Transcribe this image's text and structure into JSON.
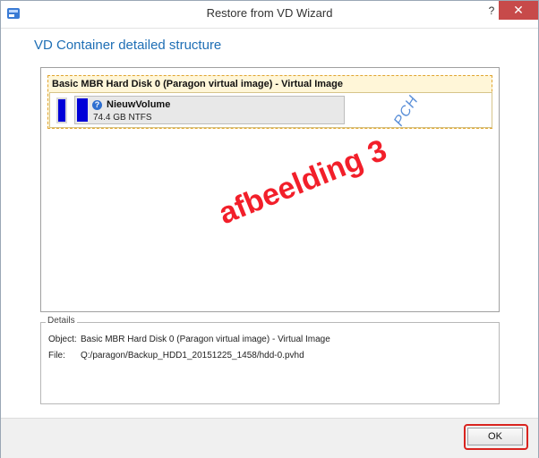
{
  "window": {
    "title": "Restore from VD Wizard",
    "help_label": "?",
    "close_label": "✕"
  },
  "heading": "VD Container detailed structure",
  "disk": {
    "title": "Basic MBR Hard Disk 0 (Paragon virtual image) - Virtual Image",
    "volume": {
      "name": "NieuwVolume",
      "size": "74.4 GB NTFS",
      "icon": "?"
    }
  },
  "annotations": {
    "pch": "PCH",
    "watermark": "afbeelding 3"
  },
  "details": {
    "legend": "Details",
    "object_label": "Object:",
    "object_value": "Basic MBR Hard Disk 0 (Paragon virtual image) - Virtual Image",
    "file_label": "File:",
    "file_value": "Q:/paragon/Backup_HDD1_20151225_1458/hdd-0.pvhd"
  },
  "buttons": {
    "ok_label": "OK"
  },
  "colors": {
    "accent": "#1f6fb5",
    "volume_blue": "#0000d8",
    "highlight_red": "#d9241f",
    "close_red": "#c74a4a"
  }
}
